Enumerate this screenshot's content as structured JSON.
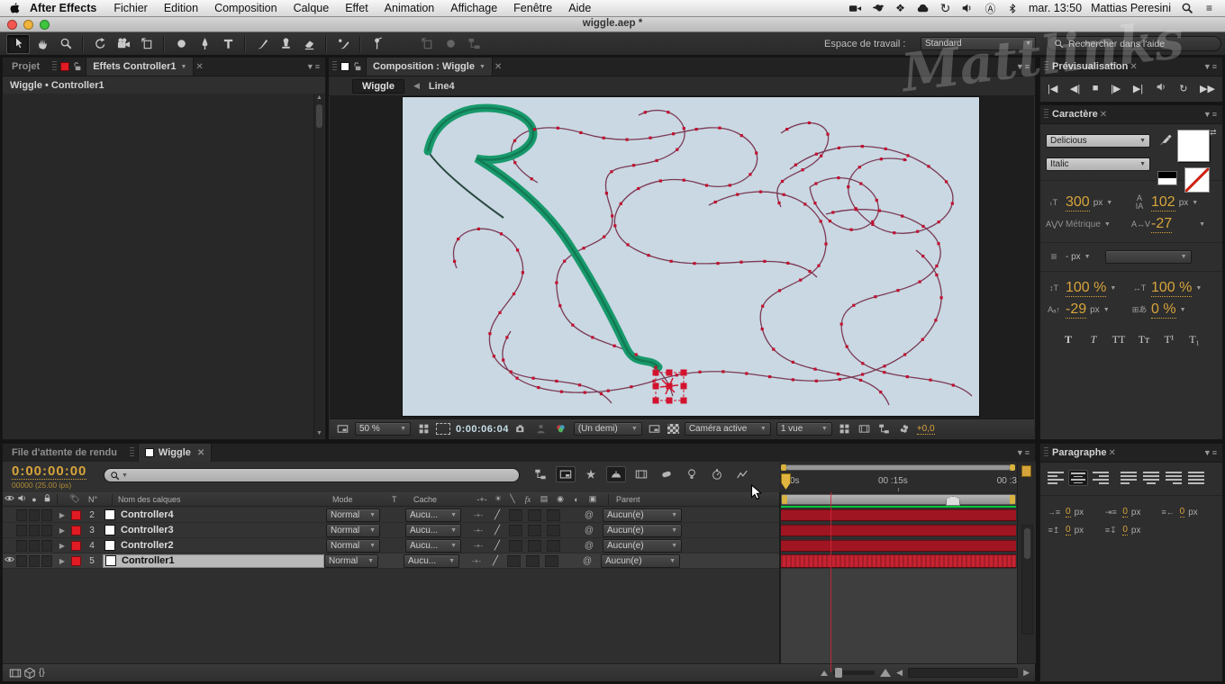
{
  "menubar": {
    "app_name": "After Effects",
    "items": [
      "Fichier",
      "Edition",
      "Composition",
      "Calque",
      "Effet",
      "Animation",
      "Affichage",
      "Fenêtre",
      "Aide"
    ],
    "clock": "mar. 13:50",
    "user": "Mattias Peresini"
  },
  "window_title": "wiggle.aep *",
  "toolbar": {
    "workspace_label": "Espace de travail :",
    "workspace_value": "Standard",
    "help_search": "Rechercher dans l'aide"
  },
  "watermark": "Mattlinks",
  "effects_panel": {
    "tab_projet": "Projet",
    "tab_effets": "Effets Controller1",
    "breadcrumb": "Wiggle • Controller1"
  },
  "comp_panel": {
    "tab": "Composition : Wiggle",
    "crumb_active": "Wiggle",
    "crumb_next": "Line4",
    "zoom": "50 %",
    "timecode": "0:00:06:04",
    "resolution": "(Un demi)",
    "camera": "Caméra active",
    "view": "1 vue",
    "exposure": "+0,0"
  },
  "preview_panel": {
    "title": "Prévisualisation",
    "buttons": [
      "|◀",
      "◀|",
      "■",
      "|▶",
      "▶|",
      "vol",
      "↻",
      "▶▶"
    ]
  },
  "character_panel": {
    "title": "Caractère",
    "font_family": "Delicious",
    "font_style": "Italic",
    "font_size": "300",
    "font_size_unit": "px",
    "leading": "102",
    "leading_unit": "px",
    "kerning": "Métrique",
    "tracking": "-27",
    "stroke_width": "- px",
    "vertical_scale": "100 %",
    "horizontal_scale": "100 %",
    "baseline_shift": "-29",
    "baseline_unit": "px",
    "tsume": "0 %",
    "style_buttons": [
      "T",
      "T",
      "TT",
      "Tᴛ",
      "T¹",
      "T₁"
    ]
  },
  "paragraph_panel": {
    "title": "Paragraphe",
    "indent_left": "0",
    "indent_right": "0",
    "indent_first": "0",
    "space_before": "0",
    "space_after": "0",
    "unit": "px"
  },
  "timeline": {
    "tab_render_queue": "File d'attente de rendu",
    "tab_comp": "Wiggle",
    "timecode": "0:00:00:00",
    "frame_info": "00000 (25.00 ips)",
    "ruler": [
      "0s",
      "00 :15s",
      "00 :3"
    ],
    "columns": {
      "number": "N°",
      "name": "Nom des calques",
      "mode": "Mode",
      "t": "T",
      "cache": "Cache",
      "parent": "Parent"
    },
    "switch_glyphs": [
      "-+-",
      "☀",
      "╲",
      "fx",
      "▤",
      "◉",
      "◐",
      "▣"
    ],
    "layers": [
      {
        "num": "2",
        "name": "Controller4",
        "mode": "Normal",
        "trkmat": "Aucu...",
        "parent": "Aucun(e)"
      },
      {
        "num": "3",
        "name": "Controller3",
        "mode": "Normal",
        "trkmat": "Aucu...",
        "parent": "Aucun(e)"
      },
      {
        "num": "4",
        "name": "Controller2",
        "mode": "Normal",
        "trkmat": "Aucu...",
        "parent": "Aucun(e)"
      },
      {
        "num": "5",
        "name": "Controller1",
        "mode": "Normal",
        "trkmat": "Aucu...",
        "parent": "Aucun(e)"
      }
    ]
  },
  "colors": {
    "accent": "#d7a43b",
    "label_red": "#e01b24",
    "layer_bar": "#a01522",
    "layer_bar_selected": "#c62331",
    "render_line": "#09c43e",
    "canvas_bg": "#c9d8e2",
    "wiggle_stroke": "#7c3a55",
    "wiggle_dot": "#c01030",
    "green_stroke": "#18996b",
    "selection_red": "#d3122e"
  }
}
